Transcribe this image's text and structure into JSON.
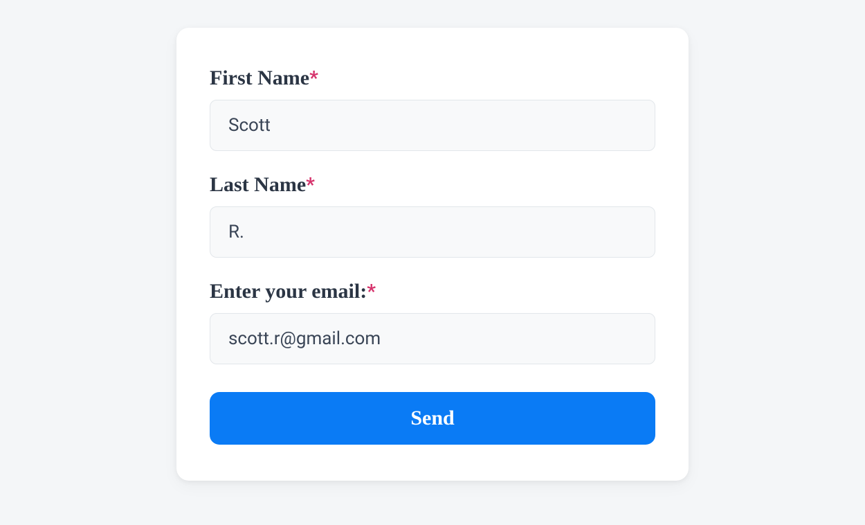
{
  "form": {
    "fields": {
      "first_name": {
        "label": "First Name",
        "required_mark": "*",
        "value": "Scott"
      },
      "last_name": {
        "label": "Last Name",
        "required_mark": "*",
        "value": "R."
      },
      "email": {
        "label": "Enter your email:",
        "required_mark": "*",
        "value": "scott.r@gmail.com"
      }
    },
    "submit_label": "Send"
  }
}
